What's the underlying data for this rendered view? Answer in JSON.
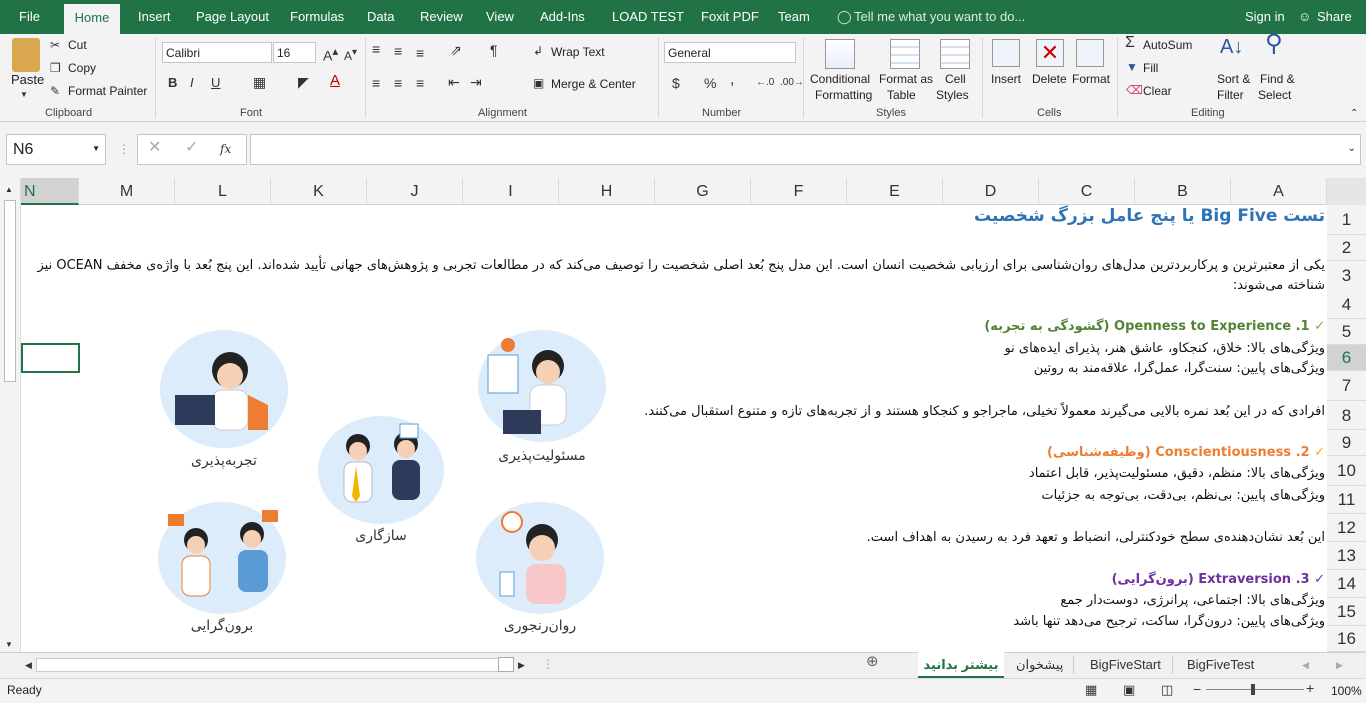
{
  "tabs": {
    "file": "File",
    "home": "Home",
    "insert": "Insert",
    "page_layout": "Page Layout",
    "formulas": "Formulas",
    "data": "Data",
    "review": "Review",
    "view": "View",
    "addins": "Add-Ins",
    "load_test": "LOAD TEST",
    "foxit": "Foxit PDF",
    "team": "Team",
    "tellme": "Tell me what you want to do...",
    "signin": "Sign in",
    "share": "Share"
  },
  "clipboard": {
    "paste": "Paste",
    "cut": "Cut",
    "copy": "Copy",
    "format_painter": "Format Painter",
    "label": "Clipboard"
  },
  "font": {
    "name": "Calibri",
    "size": "16",
    "label": "Font"
  },
  "alignment": {
    "wrap_text": "Wrap Text",
    "merge_center": "Merge & Center",
    "label": "Alignment"
  },
  "number": {
    "format": "General",
    "label": "Number",
    "currency": "$",
    "percent": "%",
    "comma": ","
  },
  "styles": {
    "conditional": "Conditional",
    "conditional2": "Formatting",
    "format_table": "Format as",
    "format_table2": "Table",
    "cell_styles": "Cell",
    "cell_styles2": "Styles",
    "label": "Styles"
  },
  "cells": {
    "insert": "Insert",
    "delete": "Delete",
    "format": "Format",
    "label": "Cells"
  },
  "editing": {
    "autosum": "AutoSum",
    "fill": "Fill",
    "clear": "Clear",
    "sort": "Sort &",
    "sort2": "Filter",
    "find": "Find &",
    "find2": "Select",
    "label": "Editing"
  },
  "formula_bar": {
    "name_box": "N6",
    "fx": "fx",
    "value": ""
  },
  "columns": [
    "N",
    "M",
    "L",
    "K",
    "J",
    "I",
    "H",
    "G",
    "F",
    "E",
    "D",
    "C",
    "B",
    "A"
  ],
  "rows": [
    "1",
    "2",
    "3",
    "4",
    "5",
    "6",
    "7",
    "8",
    "9",
    "10",
    "11",
    "12",
    "13",
    "14",
    "15",
    "16"
  ],
  "content": {
    "title": "تست Big Five یا پنج عامل بزرگ شخصیت",
    "intro1": "یکی از معتبرترین و پرکاربردترین مدل‌های روان‌شناسی برای ارزیابی شخصیت انسان است. این مدل پنج بُعد اصلی شخصیت را توصیف می‌کند که در مطالعات تجربی و پژوهش‌های جهانی تأیید شده‌اند. این پنج بُعد با واژه‌ی مخفف OCEAN نیز",
    "intro2": "شناخته می‌شوند:",
    "o_head": "1. Openness to Experience (گشودگی به تجربه)",
    "o_high": "ویژگی‌های بالا: خلاق، کنجکاو، عاشق هنر، پذیرای ایده‌های نو",
    "o_low": "ویژگی‌های پایین: سنت‌گرا، عمل‌گرا، علاقه‌مند به روتین",
    "o_desc": "افرادی که در این بُعد نمره بالایی می‌گیرند معمولاً تخیلی، ماجراجو و کنجکاو هستند و از تجربه‌های تازه و متنوع استقبال می‌کنند.",
    "c_head": "2. Conscientiousness (وظیفه‌شناسی)",
    "c_high": "ویژگی‌های بالا: منظم، دقیق، مسئولیت‌پذیر، قابل اعتماد",
    "c_low": "ویژگی‌های پایین: بی‌نظم، بی‌دقت، بی‌توجه به جزئیات",
    "c_desc": "این بُعد نشان‌دهنده‌ی سطح خودکنترلی، انضباط و تعهد فرد به رسیدن به اهداف است.",
    "e_head": "3. Extraversion (برون‌گرایی)",
    "e_high": "ویژگی‌های بالا: اجتماعی، پرانرژی، دوست‌دار جمع",
    "e_low": "ویژگی‌های پایین: درون‌گرا، ساکت، ترجیح می‌دهد تنها باشد"
  },
  "illustration": {
    "openness": "تجربه‌پذیری",
    "conscientiousness": "مسئولیت‌پذیری",
    "agreeableness": "سازگاری",
    "extraversion": "برون‌گرایی",
    "neuroticism": "روان‌رنجوری"
  },
  "sheets": {
    "s1": "بیشتر بدانید",
    "s2": "پیشخوان",
    "s3": "BigFiveStart",
    "s4": "BigFiveTest"
  },
  "status": {
    "ready": "Ready",
    "zoom": "100%"
  },
  "colors": {
    "excel_green": "#217346",
    "title_blue": "#2e74b5",
    "openness": "#548235",
    "conscientiousness": "#ed7d31",
    "extraversion": "#7030a0",
    "check_green": "#70ad47"
  }
}
